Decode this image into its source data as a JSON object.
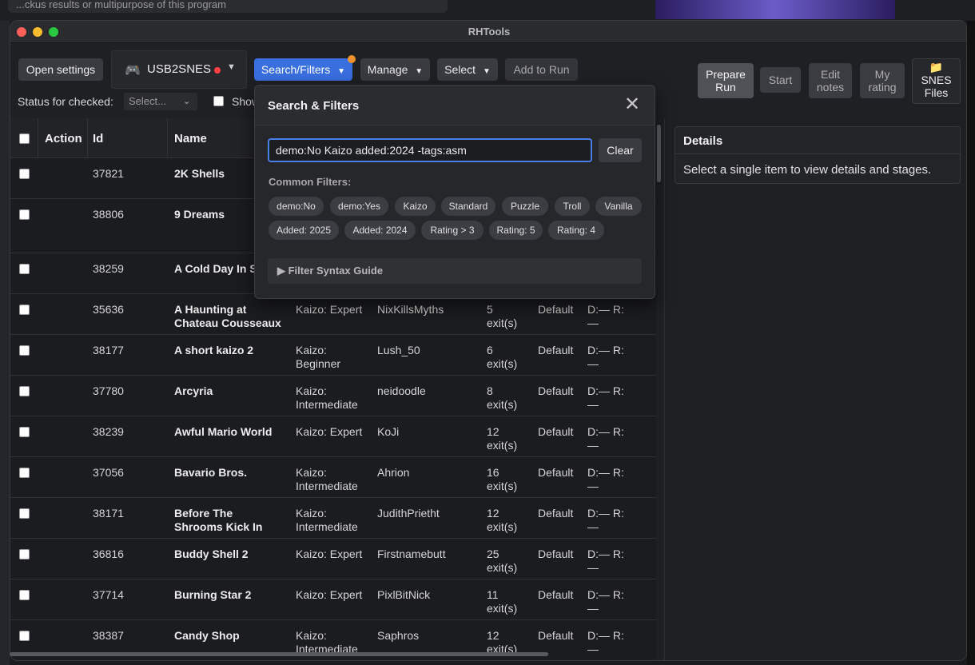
{
  "background": {
    "url_text": "...ckus results or multipurpose of this program"
  },
  "window": {
    "title": "RHTools"
  },
  "toolbar": {
    "open_settings": "Open settings",
    "device": "USB2SNES",
    "search_filters": "Search/Filters",
    "manage": "Manage",
    "select": "Select",
    "add_to_run": "Add to Run",
    "status_label": "Status for checked:",
    "status_placeholder": "Select...",
    "show_label": "Show"
  },
  "right_buttons": {
    "prepare_run_line1": "Prepare",
    "prepare_run_line2": "Run",
    "start": "Start",
    "edit_notes_line1": "Edit",
    "edit_notes_line2": "notes",
    "my_rating_line1": "My",
    "my_rating_line2": "rating",
    "snes_files_line1": "SNES",
    "snes_files_line2": "Files"
  },
  "table": {
    "headers": {
      "action": "Action",
      "id": "Id",
      "name": "Name"
    },
    "rows": [
      {
        "id": "37821",
        "name1": "2K Shells",
        "name2": "",
        "diff1": "",
        "diff2": "",
        "author": "",
        "exits1": "",
        "exits2": "",
        "mode": "",
        "rating1": "",
        "rating2": ""
      },
      {
        "id": "38806",
        "name1": "9 Dreams",
        "name2": "",
        "diff1": "",
        "diff2": "",
        "author": "",
        "exits1": "",
        "exits2": "",
        "mode": "",
        "rating1": "",
        "rating2": ""
      },
      {
        "id": "38259",
        "name1": "A Cold Day In S",
        "name2": "",
        "diff1": "",
        "diff2": "",
        "author": "",
        "exits1": "",
        "exits2": "",
        "mode": "",
        "rating1": "",
        "rating2": ""
      },
      {
        "id": "35636",
        "name1": "A Haunting at",
        "name2": "Chateau Cousseaux",
        "diff1": "Kaizo: Expert",
        "diff2": "",
        "author": "NixKillsMyths",
        "exits1": "5",
        "exits2": "exit(s)",
        "mode": "Default",
        "rating1": "D:— R:",
        "rating2": "—"
      },
      {
        "id": "38177",
        "name1": "A short kaizo 2",
        "name2": "",
        "diff1": "Kaizo:",
        "diff2": "Beginner",
        "author": "Lush_50",
        "exits1": "6",
        "exits2": "exit(s)",
        "mode": "Default",
        "rating1": "D:— R:",
        "rating2": "—"
      },
      {
        "id": "37780",
        "name1": "Arcyria",
        "name2": "",
        "diff1": "Kaizo:",
        "diff2": "Intermediate",
        "author": "neidoodle",
        "exits1": "8",
        "exits2": "exit(s)",
        "mode": "Default",
        "rating1": "D:— R:",
        "rating2": "—"
      },
      {
        "id": "38239",
        "name1": "Awful Mario World",
        "name2": "",
        "diff1": "Kaizo: Expert",
        "diff2": "",
        "author": "KoJi",
        "exits1": "12",
        "exits2": "exit(s)",
        "mode": "Default",
        "rating1": "D:— R:",
        "rating2": "—"
      },
      {
        "id": "37056",
        "name1": "Bavario Bros.",
        "name2": "",
        "diff1": "Kaizo:",
        "diff2": "Intermediate",
        "author": "Ahrion",
        "exits1": "16",
        "exits2": "exit(s)",
        "mode": "Default",
        "rating1": "D:— R:",
        "rating2": "—"
      },
      {
        "id": "38171",
        "name1": "Before The",
        "name2": "Shrooms Kick In",
        "diff1": "Kaizo:",
        "diff2": "Intermediate",
        "author": "JudithPrietht",
        "exits1": "12",
        "exits2": "exit(s)",
        "mode": "Default",
        "rating1": "D:— R:",
        "rating2": "—"
      },
      {
        "id": "36816",
        "name1": "Buddy Shell 2",
        "name2": "",
        "diff1": "Kaizo: Expert",
        "diff2": "",
        "author": "Firstnamebutt",
        "exits1": "25",
        "exits2": "exit(s)",
        "mode": "Default",
        "rating1": "D:— R:",
        "rating2": "—"
      },
      {
        "id": "37714",
        "name1": "Burning Star 2",
        "name2": "",
        "diff1": "Kaizo: Expert",
        "diff2": "",
        "author": "PixlBitNick",
        "exits1": "11",
        "exits2": "exit(s)",
        "mode": "Default",
        "rating1": "D:— R:",
        "rating2": "—"
      },
      {
        "id": "38387",
        "name1": "Candy Shop",
        "name2": "",
        "diff1": "Kaizo:",
        "diff2": "Intermediate",
        "author": "Saphros",
        "exits1": "12",
        "exits2": "exit(s)",
        "mode": "Default",
        "rating1": "D:— R:",
        "rating2": "—"
      }
    ]
  },
  "details": {
    "title": "Details",
    "body": "Select a single item to view details and stages."
  },
  "popup": {
    "title": "Search & Filters",
    "search_value": "demo:No Kaizo added:2024 -tags:asm",
    "clear": "Clear",
    "common_label": "Common Filters:",
    "chips": [
      "demo:No",
      "demo:Yes",
      "Kaizo",
      "Standard",
      "Puzzle",
      "Troll",
      "Vanilla",
      "Added: 2025",
      "Added: 2024",
      "Rating > 3",
      "Rating: 5",
      "Rating: 4"
    ],
    "syntax_guide": "▶ Filter Syntax Guide"
  },
  "colors": {
    "accent": "#3a6fe0",
    "badge": "#f0932b",
    "status_dot": "#ff4040"
  }
}
